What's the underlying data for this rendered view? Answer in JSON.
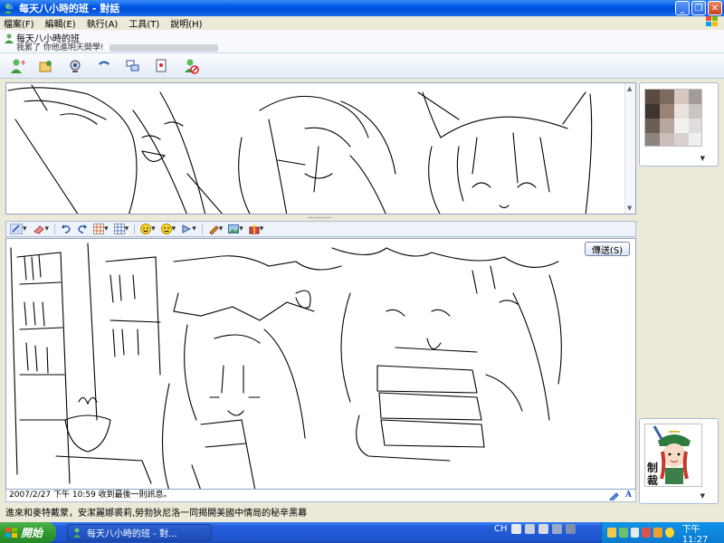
{
  "window": {
    "title": "每天八小時的班 - 對話"
  },
  "menu": {
    "items": [
      "檔案(F)",
      "編輯(E)",
      "執行(A)",
      "工具(T)",
      "說明(H)"
    ]
  },
  "contact": {
    "name": "每天八小時的班",
    "status": "我累了 你他進明天開學!"
  },
  "toolbar": {
    "icons": [
      "invite-contact-icon",
      "send-files-icon",
      "webcam-icon",
      "call-icon",
      "activities-icon",
      "games-icon",
      "block-icon"
    ]
  },
  "compose": {
    "send_label": "傳送(S)"
  },
  "status_line": {
    "last_message": "2007/2/27 下午 10:59 收到最後一則訊息。"
  },
  "notify": {
    "text": "進來和麥特戴蒙，安潔麗娜裘莉,勞勃狄尼洛一同揭開美國中情局的秘辛黑幕"
  },
  "taskbar": {
    "start_label": "開始",
    "task_label": "每天八小時的班 - 對...",
    "lang": "CH",
    "clock": "下午 11:27"
  },
  "colors": {
    "titlebar": "#0058e6",
    "taskbar": "#245edb",
    "start": "#2f9a2f"
  },
  "sticker": {
    "text": "制裁"
  }
}
